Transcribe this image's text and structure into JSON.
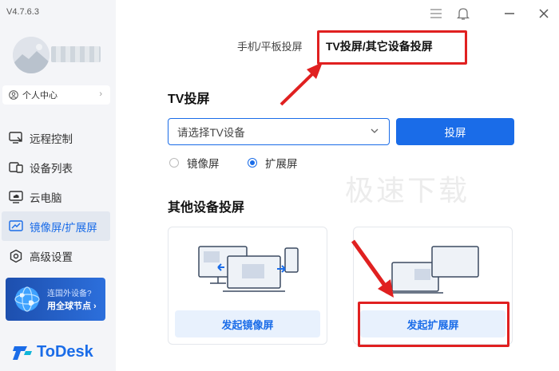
{
  "app": {
    "version": "V4.7.6.3",
    "logo_text": "ToDesk"
  },
  "sidebar": {
    "personal_center": "个人中心",
    "items": [
      {
        "label": "远程控制",
        "icon": "remote-control-icon"
      },
      {
        "label": "设备列表",
        "icon": "device-list-icon"
      },
      {
        "label": "云电脑",
        "icon": "cloud-pc-icon"
      },
      {
        "label": "镜像屏/扩展屏",
        "icon": "mirror-screen-icon",
        "active": true
      },
      {
        "label": "高级设置",
        "icon": "settings-icon"
      }
    ],
    "promo": {
      "line1": "连国外设备?",
      "line2": "用全球节点 ›"
    }
  },
  "tabs": {
    "phone_tablet": "手机/平板投屏",
    "tv_other": "TV投屏/其它设备投屏"
  },
  "tv_section": {
    "title": "TV投屏",
    "select_placeholder": "请选择TV设备",
    "cast_button": "投屏",
    "mode_options": [
      {
        "label": "镜像屏",
        "selected": false
      },
      {
        "label": "扩展屏",
        "selected": true
      }
    ]
  },
  "watermark": "极速下载",
  "other_section": {
    "title": "其他设备投屏",
    "mirror_button": "发起镜像屏",
    "extend_button": "发起扩展屏"
  },
  "colors": {
    "accent": "#1a6ce8",
    "highlight": "#e02020",
    "sidebar_bg": "#f4f5f8"
  }
}
